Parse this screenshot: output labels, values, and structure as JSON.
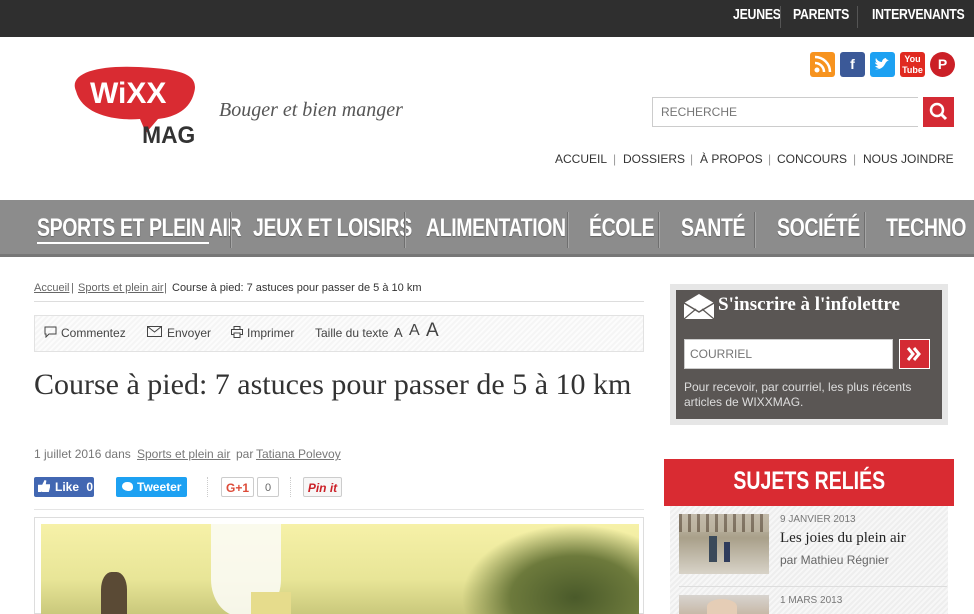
{
  "topbar": {
    "links": [
      "JEUNES",
      "PARENTS",
      "INTERVENANTS"
    ]
  },
  "header": {
    "logo_top": "WiXX",
    "logo_bottom": "MAG",
    "tagline": "Bouger et bien manger",
    "search_placeholder": "RECHERCHE",
    "social": [
      "rss-icon",
      "facebook-icon",
      "twitter-icon",
      "youtube-icon",
      "pinterest-icon"
    ],
    "utility_nav": [
      "ACCUEIL",
      "DOSSIERS",
      "À PROPOS",
      "CONCOURS",
      "NOUS JOINDRE"
    ]
  },
  "mainnav": [
    "SPORTS ET PLEIN AIR",
    "JEUX ET LOISIRS",
    "ALIMENTATION",
    "ÉCOLE",
    "SANTÉ",
    "SOCIÉTÉ",
    "TECHNO"
  ],
  "breadcrumb": {
    "home": "Accueil",
    "section": "Sports et plein air",
    "current": "Course à pied: 7 astuces pour passer de 5 à 10 km"
  },
  "toolbar": {
    "comment": "Commentez",
    "send": "Envoyer",
    "print": "Imprimer",
    "textsize": "Taille du texte",
    "a_small": "A",
    "a_medium": "A",
    "a_large": "A"
  },
  "article": {
    "title": "Course à pied: 7 astuces pour passer de 5 à 10 km",
    "date": "1 juillet 2016 dans",
    "section": "Sports et plein air",
    "by": "par",
    "author": "Tatiana Polevoy"
  },
  "share": {
    "like": "Like",
    "like_count": "0",
    "tweet": "Tweeter",
    "gplus": "G+1",
    "gplus_count": "0",
    "pin": "Pin it"
  },
  "newsletter": {
    "title": "S'inscrire à l'infolettre",
    "placeholder": "COURRIEL",
    "desc": "Pour recevoir, par courriel, les plus récents articles de WIXXMAG."
  },
  "related": {
    "title": "SUJETS RELIÉS",
    "items": [
      {
        "date": "9 JANVIER 2013",
        "title": "Les joies du plein air",
        "by": "par Mathieu Régnier"
      },
      {
        "date": "1 MARS 2013",
        "title": "",
        "by": ""
      }
    ]
  },
  "colors": {
    "accent": "#d42a34",
    "nav_bg": "#8c8c8c",
    "topbar_bg": "#2f2f2f"
  }
}
